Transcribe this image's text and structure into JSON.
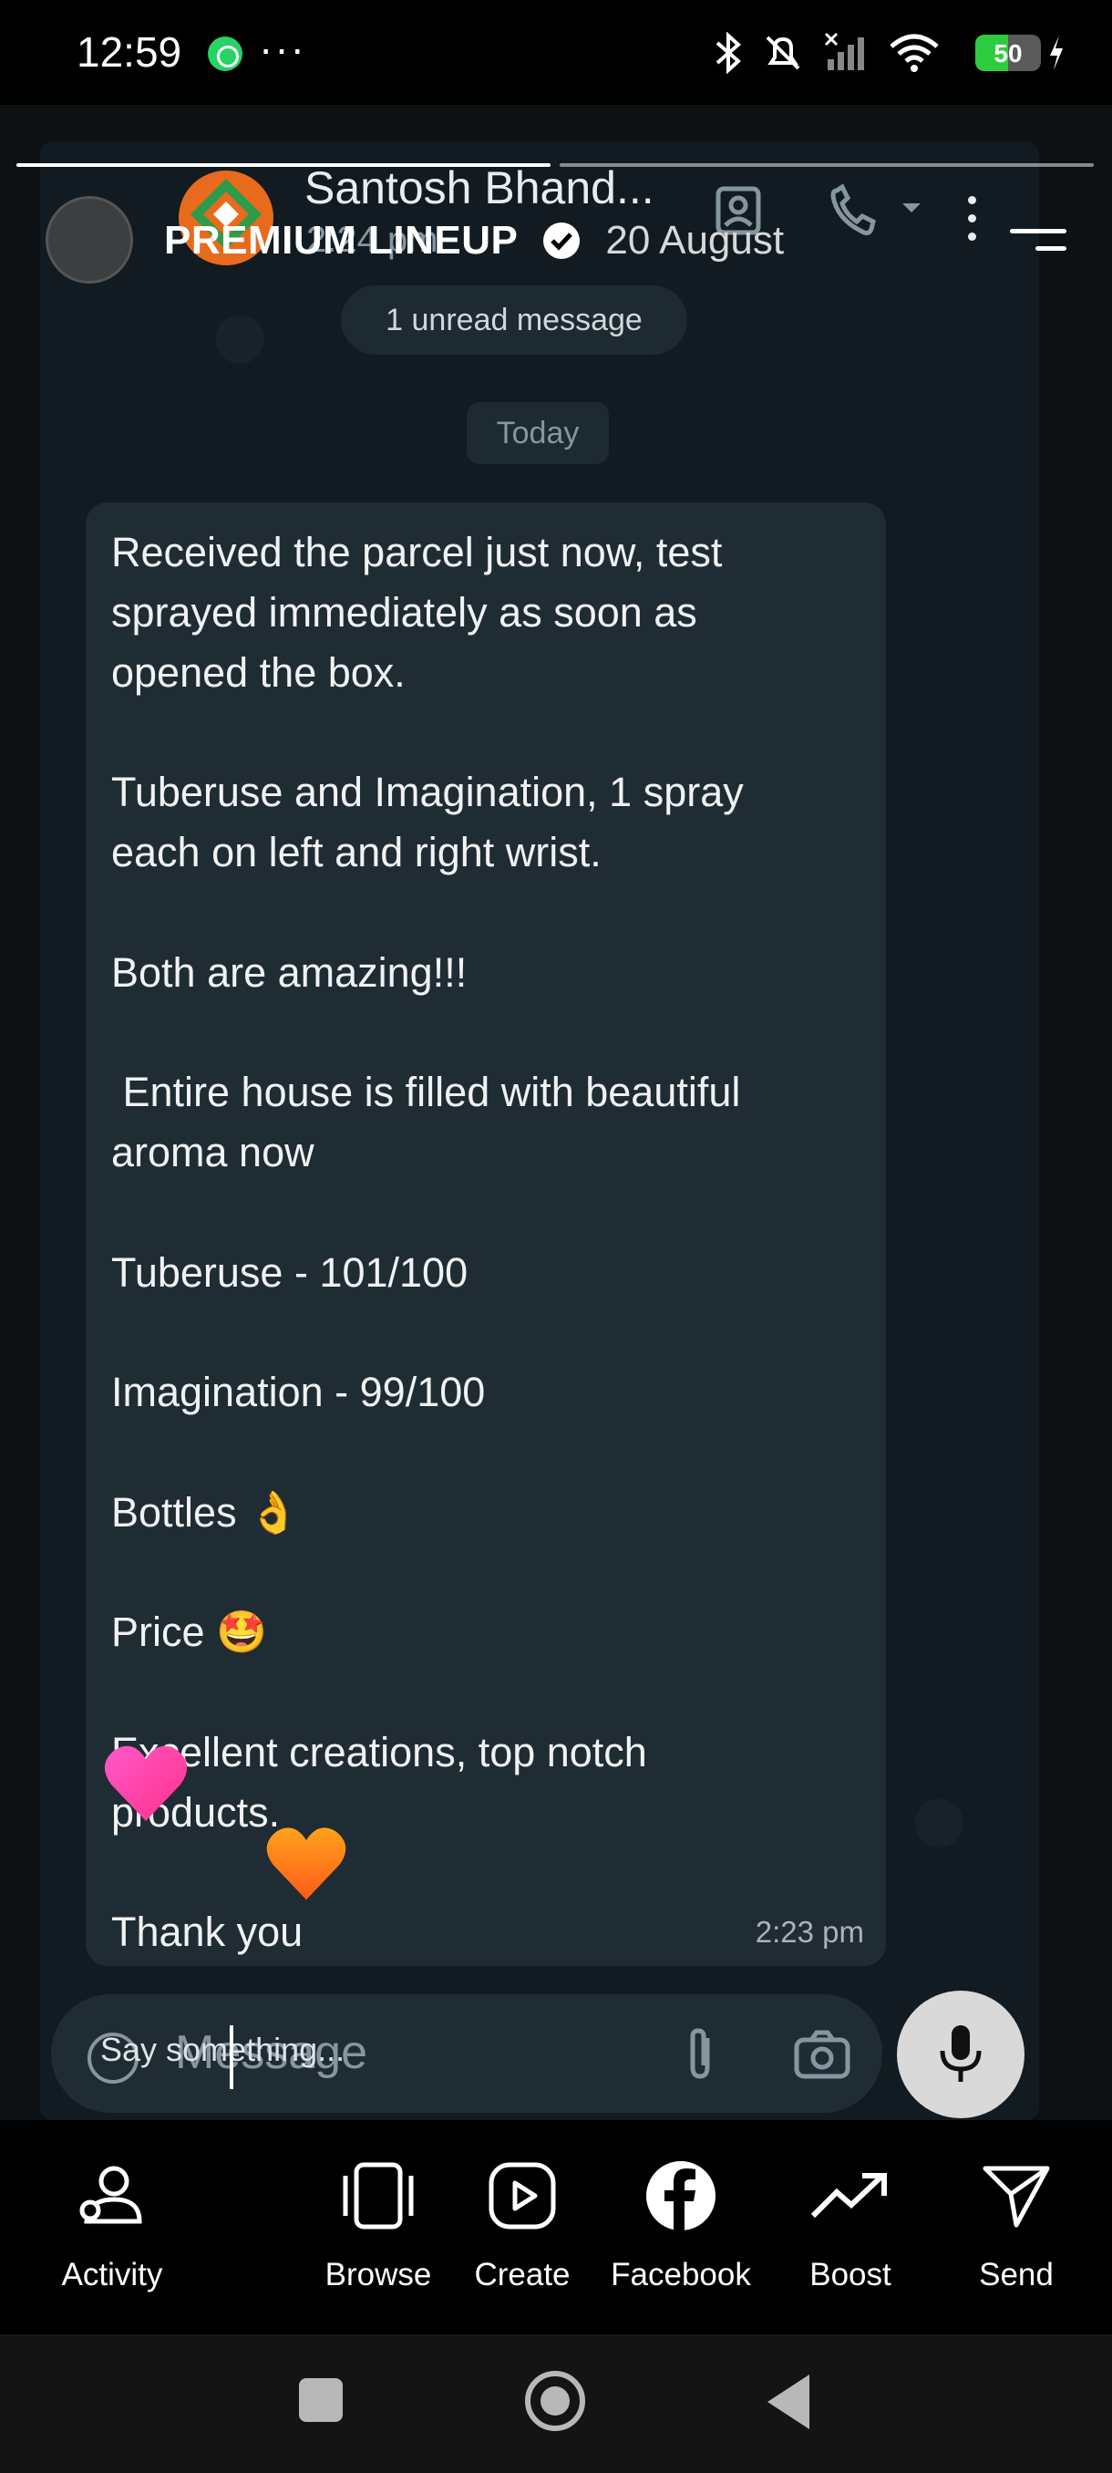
{
  "status_bar": {
    "time": "12:59",
    "more": "···",
    "battery_level": "50",
    "battery_fraction": 0.5,
    "network_label": "6"
  },
  "story": {
    "title": "PREMIUM LINEUP",
    "date": "20 August",
    "segments_total": 2,
    "segments_done": 1
  },
  "whatsapp": {
    "contact_name": "Santosh Bhand...",
    "contact_sub": "2:24 pm",
    "unread_pill": "1 unread message",
    "date_pill": "Today",
    "message_lines": [
      "Received the parcel just now, test",
      "sprayed immediately as soon as",
      "opened the box.",
      "",
      "Tuberuse and Imagination, 1 spray",
      "each on left and right wrist.",
      "",
      "Both are amazing!!!",
      "",
      " Entire house is filled with beautiful",
      "aroma now",
      "",
      "Tuberuse - 101/100",
      "",
      "Imagination - 99/100",
      "",
      "Bottles 👌",
      "",
      "Price 🤩",
      "",
      "Excellent creations, top notch",
      "products.",
      "",
      "Thank you"
    ],
    "message_time": "2:23 pm",
    "composer_placeholder": "Message"
  },
  "story_reply": {
    "placeholder": "Say something..."
  },
  "bottom_nav": [
    {
      "label": "Activity",
      "icon": "activity-icon"
    },
    {
      "label": "Browse",
      "icon": "browse-icon"
    },
    {
      "label": "Create",
      "icon": "create-icon"
    },
    {
      "label": "Facebook",
      "icon": "facebook-icon"
    },
    {
      "label": "Boost",
      "icon": "boost-icon"
    },
    {
      "label": "Send",
      "icon": "send-icon"
    }
  ],
  "colors": {
    "whatsapp_bg": "#111b21",
    "bubble_bg": "#202c33",
    "heart_pink": "#ff3cac",
    "heart_orange": "#ff7a1a"
  }
}
